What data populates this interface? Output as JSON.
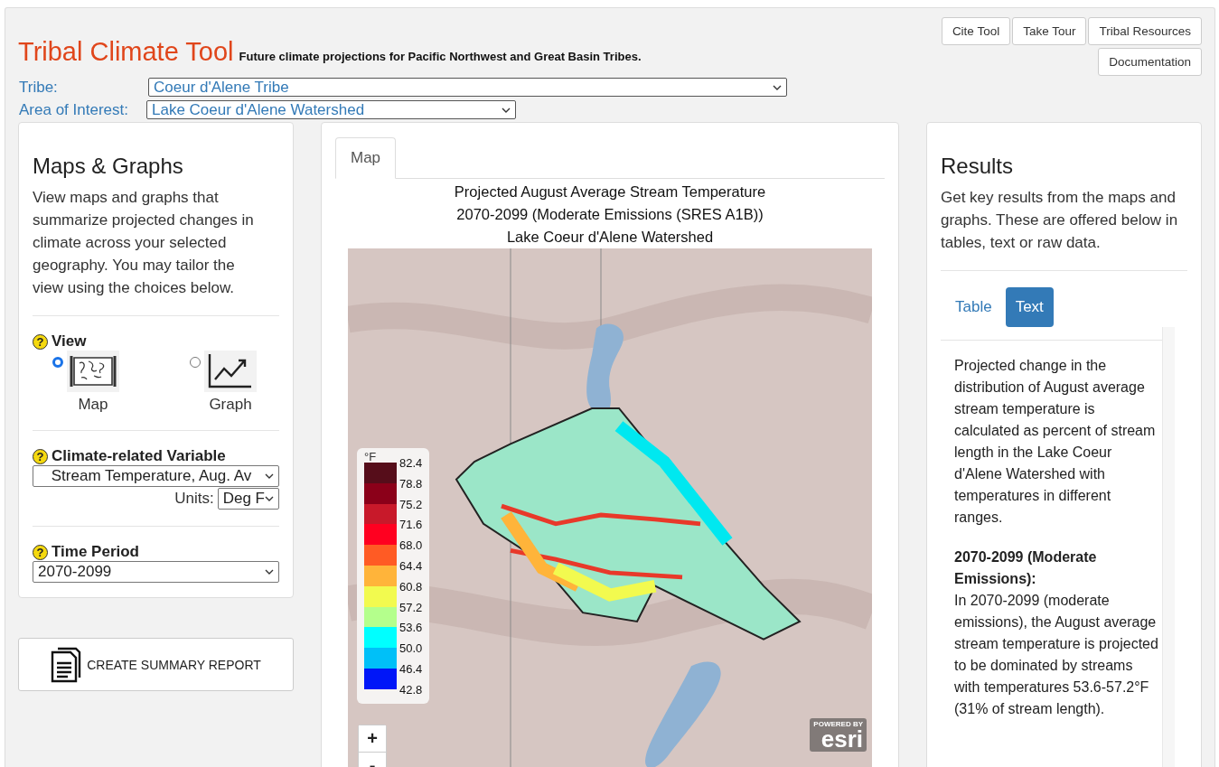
{
  "header": {
    "title": "Tribal Climate Tool",
    "subtitle": "Future climate projections for Pacific Northwest and Great Basin Tribes.",
    "buttons": [
      "Cite Tool",
      "Take Tour",
      "Tribal Resources",
      "Documentation"
    ]
  },
  "selectors": [
    {
      "label": "Tribe:",
      "value": "Coeur d'Alene Tribe",
      "kind": "wide"
    },
    {
      "label": "Area of Interest:",
      "value": "Lake Coeur d'Alene Watershed",
      "kind": "narrow"
    }
  ],
  "left_panel": {
    "title": "Maps & Graphs",
    "description": "View maps and graphs that summarize projected changes in climate across your selected geography. You may tailor the view using the choices below.",
    "view": {
      "help": "?",
      "label": "View",
      "options": [
        {
          "label": "Map",
          "kind": "map",
          "selected": true
        },
        {
          "label": "Graph",
          "kind": "graph",
          "selected": false
        }
      ]
    },
    "variable": {
      "help": "?",
      "label": "Climate-related Variable",
      "value": "Stream Temperature, Aug. Av",
      "units_label": "Units:",
      "units_value": "Deg F"
    },
    "time_period": {
      "help": "?",
      "label": "Time Period",
      "value": "2070-2099"
    },
    "report_button": "CREATE SUMMARY REPORT"
  },
  "center_panel": {
    "tabs": [
      {
        "label": "Map",
        "selected": true
      }
    ],
    "map_title": [
      "Projected August Average Stream Temperature",
      "2070-2099 (Moderate Emissions (SRES A1B))",
      "Lake Coeur d'Alene Watershed"
    ],
    "legend": {
      "unit": "°F",
      "items": [
        {
          "label": "82.4",
          "color": "#560d1a"
        },
        {
          "label": "78.8",
          "color": "#8b0019"
        },
        {
          "label": "75.2",
          "color": "#c8192a"
        },
        {
          "label": "71.6",
          "color": "#ff0020"
        },
        {
          "label": "68.0",
          "color": "#ff5b24"
        },
        {
          "label": "64.4",
          "color": "#ffb43a"
        },
        {
          "label": "60.8",
          "color": "#f2fa4f"
        },
        {
          "label": "57.2",
          "color": "#b4ff8c"
        },
        {
          "label": "53.6",
          "color": "#00ffff"
        },
        {
          "label": "50.0",
          "color": "#00c0f8"
        },
        {
          "label": "46.4",
          "color": "#0016f8"
        }
      ],
      "last_label": "42.8"
    },
    "zoom": [
      "+",
      "-"
    ],
    "attribution": {
      "small": "POWERED BY",
      "logo": "esri"
    }
  },
  "right_panel": {
    "title": "Results",
    "description": "Get key results from the maps and graphs. These are offered below in tables, text or raw data.",
    "tabs": [
      {
        "label": "Table",
        "selected": false
      },
      {
        "label": "Text",
        "selected": true
      }
    ],
    "intro": "Projected change in the distribution of August average stream temperature is calculated as percent of stream length in the Lake Coeur d'Alene Watershed with temperatures in different ranges.",
    "section_heading": "2070-2099 (Moderate Emissions):",
    "section_text": "In 2070-2099 (moderate emissions), the August average stream temperature is projected to be dominated by streams with temperatures 53.6-57.2°F (31% of stream length)."
  }
}
